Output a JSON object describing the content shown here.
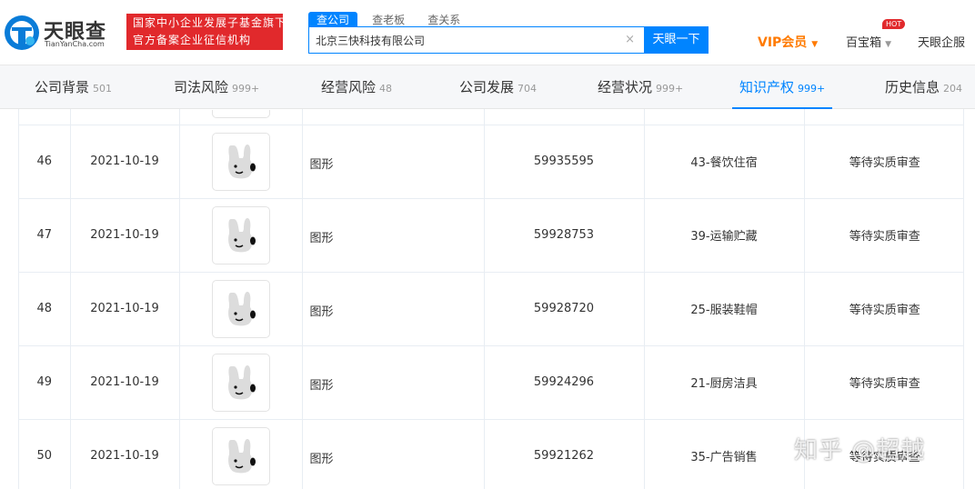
{
  "brand": {
    "name": "天眼查",
    "domain": "TianYanCha.com",
    "banner_line1": "国家中小企业发展子基金旗下",
    "banner_line2": "官方备案企业征信机构",
    "accent": "#0084ff",
    "banner_color": "#e1292c"
  },
  "search": {
    "tabs": [
      "查公司",
      "查老板",
      "查关系"
    ],
    "value": "北京三快科技有限公司",
    "clear_icon": "×",
    "button": "天眼一下"
  },
  "nav": {
    "vip": "VIP会员",
    "vip_caret": "▼",
    "baobox": "百宝箱",
    "baobox_caret": "▼",
    "hot": "HOT",
    "enterprise": "天眼企服"
  },
  "page_tabs": [
    {
      "label": "公司背景",
      "count": "501"
    },
    {
      "label": "司法风险",
      "count": "999+"
    },
    {
      "label": "经营风险",
      "count": "48"
    },
    {
      "label": "公司发展",
      "count": "704"
    },
    {
      "label": "经营状况",
      "count": "999+"
    },
    {
      "label": "知识产权",
      "count": "999+"
    },
    {
      "label": "历史信息",
      "count": "204"
    }
  ],
  "active_tab": "知识产权",
  "rows": [
    {
      "index": "46",
      "date": "2021-10-19",
      "name": "图形",
      "reg_no": "59935595",
      "class": "43-餐饮住宿",
      "status": "等待实质审查"
    },
    {
      "index": "47",
      "date": "2021-10-19",
      "name": "图形",
      "reg_no": "59928753",
      "class": "39-运输贮藏",
      "status": "等待实质审查"
    },
    {
      "index": "48",
      "date": "2021-10-19",
      "name": "图形",
      "reg_no": "59928720",
      "class": "25-服装鞋帽",
      "status": "等待实质审查"
    },
    {
      "index": "49",
      "date": "2021-10-19",
      "name": "图形",
      "reg_no": "59924296",
      "class": "21-厨房洁具",
      "status": "等待实质审查"
    },
    {
      "index": "50",
      "date": "2021-10-19",
      "name": "图形",
      "reg_no": "59921262",
      "class": "35-广告销售",
      "status": "等待实质审查"
    }
  ],
  "watermark": "知乎 @超越"
}
